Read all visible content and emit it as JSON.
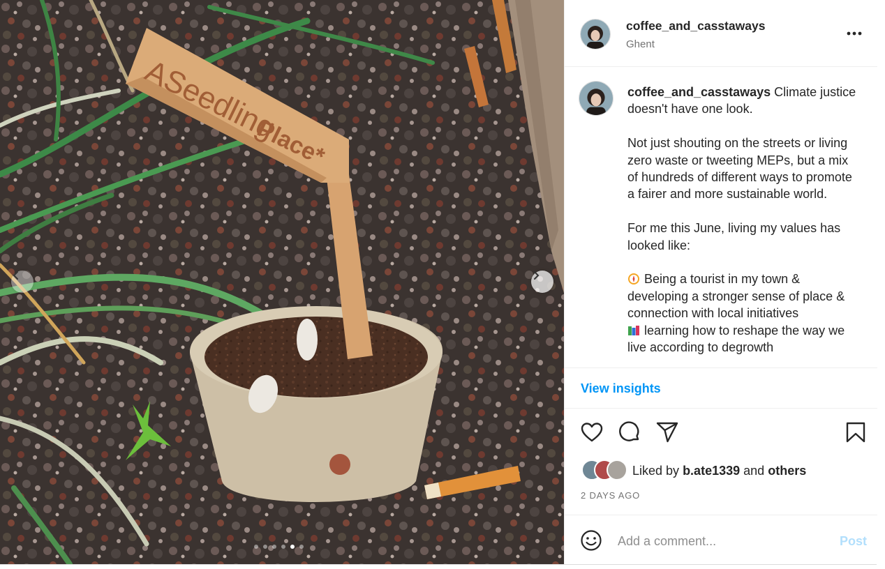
{
  "post": {
    "image": {
      "alt": "",
      "sign_text": "ASeedling",
      "sign_text_bold": "Place*",
      "carousel": {
        "count": 6,
        "active": 5
      }
    },
    "header": {
      "username": "coffee_and_casstaways",
      "location": "Ghent",
      "more_icon": "more-horizontal-icon"
    },
    "caption": {
      "username": "coffee_and_casstaways",
      "first_line": "Climate justice doesn't have one look.",
      "paragraphs": [
        "Not just shouting on the streets or living zero waste or tweeting MEPs, but a mix of hundreds of different ways to promote a fairer and more sustainable world.",
        "For me this June, living my values has looked like:"
      ],
      "list_items": [
        {
          "icon": "compass-emoji",
          "text": "Being a tourist in my town & developing a stronger sense of place & connection with local initiatives"
        },
        {
          "icon": "books-emoji",
          "text": "learning how to reshape the way we live according to degrowth"
        }
      ]
    },
    "insights_label": "View insights",
    "actions": {
      "like_icon": "heart-icon",
      "comment_icon": "comment-icon",
      "share_icon": "share-icon",
      "save_icon": "bookmark-icon"
    },
    "likes": {
      "prefix": "Liked by",
      "user": "b.ate1339",
      "conjunction": "and",
      "others": "others"
    },
    "timestamp": "2 DAYS AGO",
    "comment": {
      "placeholder": "Add a comment...",
      "post_label": "Post"
    },
    "colors": {
      "link": "#0095f6",
      "post_disabled": "#b2dffc",
      "secondary_text": "#737373"
    }
  }
}
